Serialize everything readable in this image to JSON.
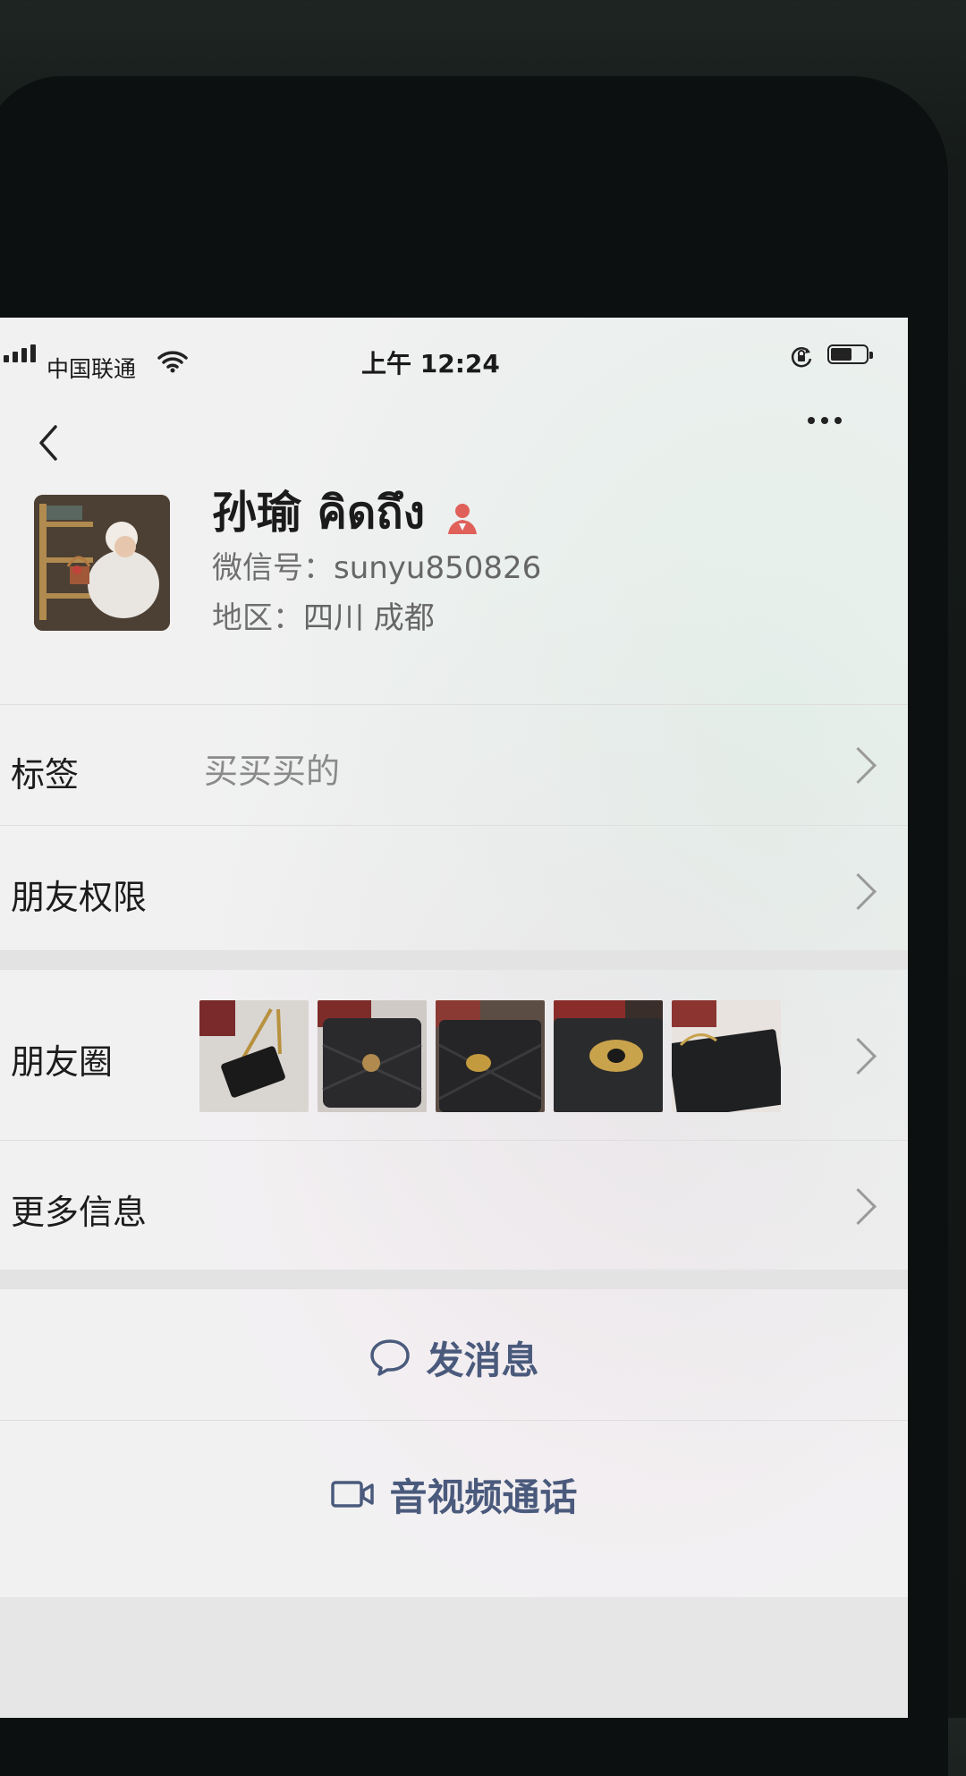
{
  "status_bar": {
    "carrier": "中国联通",
    "time": "上午 12:24",
    "battery_level": 0.6
  },
  "profile": {
    "name": "孙瑜 คิดถึง",
    "wechat_id_label": "微信号：",
    "wechat_id": "sunyu850826",
    "region_label": "地区：",
    "region": "四川 成都"
  },
  "rows": {
    "tags": {
      "label": "标签",
      "value": "买买买的"
    },
    "permissions": {
      "label": "朋友权限"
    },
    "moments": {
      "label": "朋友圈"
    },
    "more_info": {
      "label": "更多信息"
    }
  },
  "actions": {
    "message": {
      "label": "发消息",
      "icon": "chat-bubble-icon"
    },
    "call": {
      "label": "音视频通话",
      "icon": "video-camera-icon"
    }
  },
  "colors": {
    "accent": "#4a5a7c",
    "badge": "#e0605a",
    "divider": "#dedede"
  },
  "icons": [
    "back-chevron-icon",
    "more-dots-icon",
    "person-badge-icon",
    "chevron-right-icon",
    "wifi-icon",
    "signal-icon",
    "rotation-lock-icon",
    "battery-icon"
  ]
}
